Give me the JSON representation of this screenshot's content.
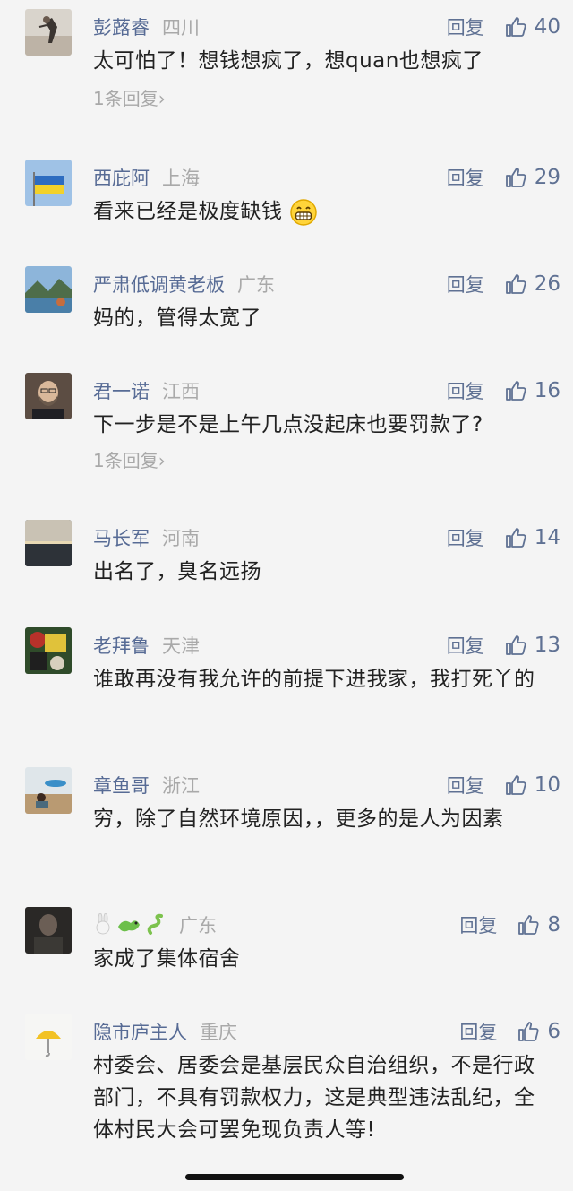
{
  "ui": {
    "reply_label": "回复",
    "sub_reply_text": "1条回复",
    "sub_reply_chevron": "›"
  },
  "comments": [
    {
      "name": "彭蕗睿",
      "region": "四川",
      "likes": "40",
      "text": "太可怕了！想钱想疯了，想quan也想疯了"
    },
    {
      "name": "西庇阿",
      "region": "上海",
      "likes": "29",
      "text": "看来已经是极度缺钱"
    },
    {
      "name": "严肃低调黄老板",
      "region": "广东",
      "likes": "26",
      "text": "妈的，管得太宽了"
    },
    {
      "name": "君一诺",
      "region": "江西",
      "likes": "16",
      "text": "下一步是不是上午几点没起床也要罚款了?"
    },
    {
      "name": "马长军",
      "region": "河南",
      "likes": "14",
      "text": "出名了，臭名远扬"
    },
    {
      "name": "老拜鲁",
      "region": "天津",
      "likes": "13",
      "text": "谁敢再没有我允许的前提下进我家，我打死丫的"
    },
    {
      "name": "章鱼哥",
      "region": "浙江",
      "likes": "10",
      "text": "穷，除了自然环境原因，，更多的是人为因素"
    },
    {
      "name": "",
      "region": "广东",
      "likes": "8",
      "text": "家成了集体宿舍"
    },
    {
      "name": "隐市庐主人",
      "region": "重庆",
      "likes": "6",
      "text": "村委会、居委会是基层民众自治组织，不是行政部门，不具有罚款权力，这是典型违法乱纪，全体村民大会可罢免现负责人等!"
    }
  ],
  "colors": {
    "name": "#576b95",
    "region": "#a9a9a9",
    "body_text": "#222222",
    "background": "#f4f4f4"
  }
}
